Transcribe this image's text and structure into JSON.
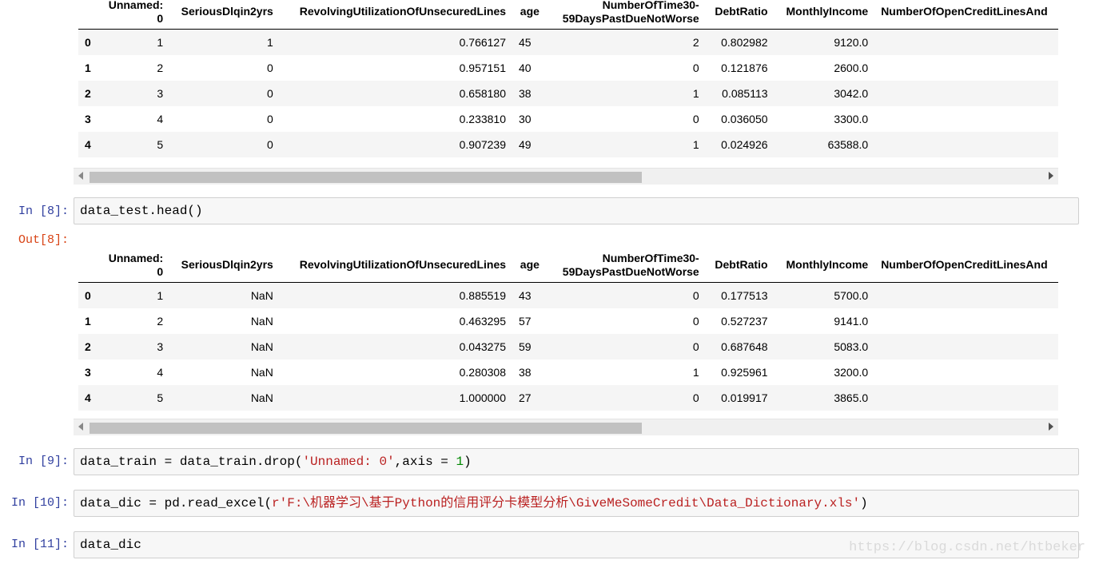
{
  "table1": {
    "columns": [
      "Unnamed: 0",
      "SeriousDlqin2yrs",
      "RevolvingUtilizationOfUnsecuredLines",
      "age",
      "NumberOfTime30-59DaysPastDueNotWorse",
      "DebtRatio",
      "MonthlyIncome",
      "NumberOfOpenCreditLinesAnd"
    ],
    "rows": [
      {
        "idx": "0",
        "c": [
          "1",
          "1",
          "0.766127",
          "45",
          "2",
          "0.802982",
          "9120.0",
          ""
        ]
      },
      {
        "idx": "1",
        "c": [
          "2",
          "0",
          "0.957151",
          "40",
          "0",
          "0.121876",
          "2600.0",
          ""
        ]
      },
      {
        "idx": "2",
        "c": [
          "3",
          "0",
          "0.658180",
          "38",
          "1",
          "0.085113",
          "3042.0",
          ""
        ]
      },
      {
        "idx": "3",
        "c": [
          "4",
          "0",
          "0.233810",
          "30",
          "0",
          "0.036050",
          "3300.0",
          ""
        ]
      },
      {
        "idx": "4",
        "c": [
          "5",
          "0",
          "0.907239",
          "49",
          "1",
          "0.024926",
          "63588.0",
          ""
        ]
      }
    ]
  },
  "cell8": {
    "in_prompt": "In [8]:",
    "code": "data_test.head()",
    "out_prompt": "Out[8]:"
  },
  "table2": {
    "columns": [
      "Unnamed: 0",
      "SeriousDlqin2yrs",
      "RevolvingUtilizationOfUnsecuredLines",
      "age",
      "NumberOfTime30-59DaysPastDueNotWorse",
      "DebtRatio",
      "MonthlyIncome",
      "NumberOfOpenCreditLinesAnd"
    ],
    "rows": [
      {
        "idx": "0",
        "c": [
          "1",
          "NaN",
          "0.885519",
          "43",
          "0",
          "0.177513",
          "5700.0",
          ""
        ]
      },
      {
        "idx": "1",
        "c": [
          "2",
          "NaN",
          "0.463295",
          "57",
          "0",
          "0.527237",
          "9141.0",
          ""
        ]
      },
      {
        "idx": "2",
        "c": [
          "3",
          "NaN",
          "0.043275",
          "59",
          "0",
          "0.687648",
          "5083.0",
          ""
        ]
      },
      {
        "idx": "3",
        "c": [
          "4",
          "NaN",
          "0.280308",
          "38",
          "1",
          "0.925961",
          "3200.0",
          ""
        ]
      },
      {
        "idx": "4",
        "c": [
          "5",
          "NaN",
          "1.000000",
          "27",
          "0",
          "0.019917",
          "3865.0",
          ""
        ]
      }
    ]
  },
  "cell9": {
    "in_prompt": "In [9]:",
    "code_pre": "data_train = data_train.drop(",
    "code_str": "'Unnamed: 0'",
    "code_mid": ",axis = ",
    "code_num": "1",
    "code_post": ")"
  },
  "cell10": {
    "in_prompt": "In [10]:",
    "code_pre": "data_dic = pd.read_excel(",
    "code_str": "r'F:\\机器学习\\基于Python的信用评分卡模型分析\\GiveMeSomeCredit\\Data_Dictionary.xls'",
    "code_post": ")"
  },
  "cell11": {
    "in_prompt": "In [11]:",
    "code": "data_dic"
  },
  "scrollbar": {
    "thumb_fraction": 0.58
  },
  "watermark": "https://blog.csdn.net/htbeker",
  "colors": {
    "in_prompt": "#303f9f",
    "out_prompt": "#d84315",
    "string": "#ba2121",
    "number": "#008800"
  }
}
